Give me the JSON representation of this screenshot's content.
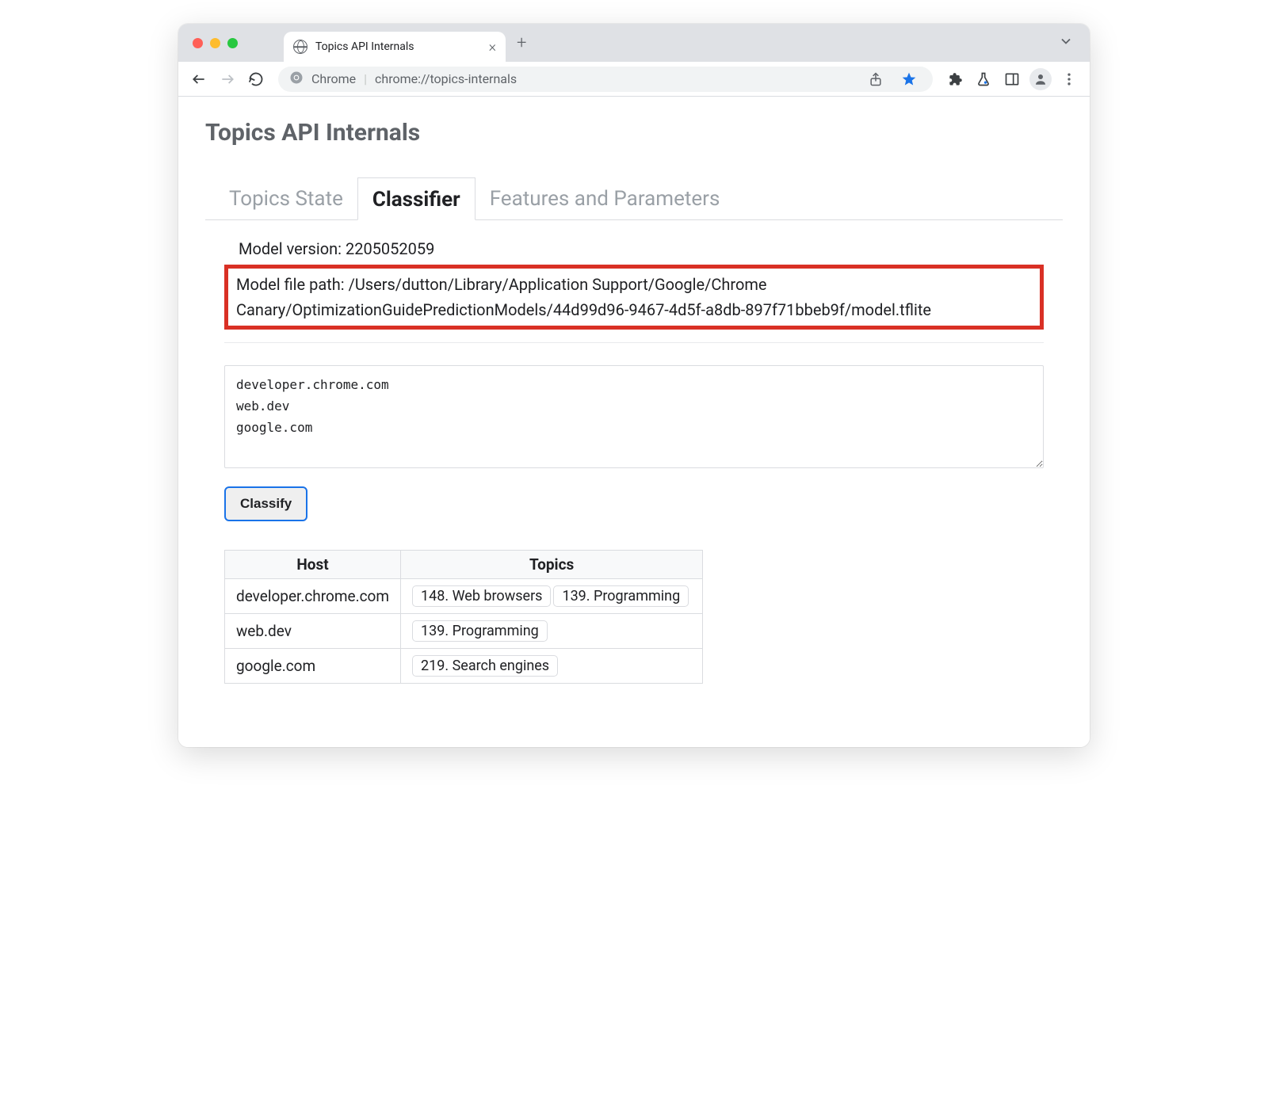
{
  "browser": {
    "tab_title": "Topics API Internals",
    "omnibox_label": "Chrome",
    "omnibox_url": "chrome://topics-internals"
  },
  "page": {
    "title": "Topics API Internals",
    "tabs": {
      "topics_state": "Topics State",
      "classifier": "Classifier",
      "features": "Features and Parameters"
    },
    "model_version_label": "Model version: 2205052059",
    "model_file_path": "Model file path: /Users/dutton/Library/Application Support/Google/Chrome Canary/OptimizationGuidePredictionModels/44d99d96-9467-4d5f-a8db-897f71bbeb9f/model.tflite",
    "textarea_value": "developer.chrome.com\nweb.dev\ngoogle.com",
    "classify_button": "Classify",
    "table": {
      "header_host": "Host",
      "header_topics": "Topics",
      "rows": [
        {
          "host": "developer.chrome.com",
          "topics": [
            "148. Web browsers",
            "139. Programming"
          ]
        },
        {
          "host": "web.dev",
          "topics": [
            "139. Programming"
          ]
        },
        {
          "host": "google.com",
          "topics": [
            "219. Search engines"
          ]
        }
      ]
    }
  }
}
